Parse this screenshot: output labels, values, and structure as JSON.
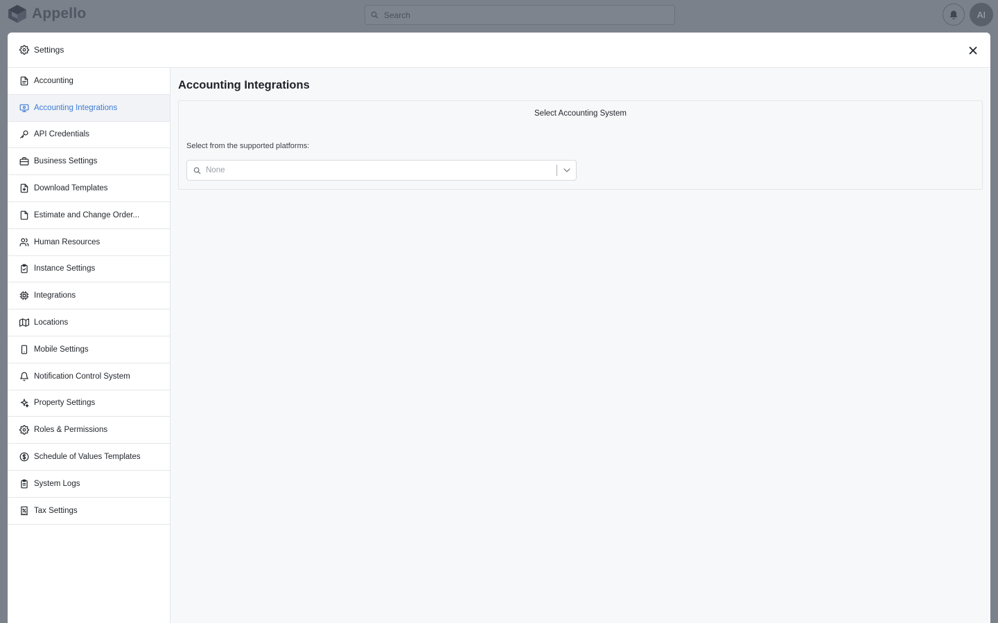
{
  "app": {
    "brand_name": "Appello",
    "search_placeholder": "Search",
    "avatar_initials": "AI"
  },
  "modal": {
    "title": "Settings"
  },
  "sidebar": {
    "items": [
      {
        "label": "Accounting",
        "icon": "file-text-icon"
      },
      {
        "label": "Accounting Integrations",
        "icon": "monitor-dollar-icon",
        "active": true
      },
      {
        "label": "API Credentials",
        "icon": "key-icon"
      },
      {
        "label": "Business Settings",
        "icon": "briefcase-icon"
      },
      {
        "label": "Download Templates",
        "icon": "file-download-icon"
      },
      {
        "label": "Estimate and Change Order...",
        "icon": "file-icon"
      },
      {
        "label": "Human Resources",
        "icon": "users-icon"
      },
      {
        "label": "Instance Settings",
        "icon": "clipboard-check-icon"
      },
      {
        "label": "Integrations",
        "icon": "chip-icon"
      },
      {
        "label": "Locations",
        "icon": "map-icon"
      },
      {
        "label": "Mobile Settings",
        "icon": "smartphone-icon"
      },
      {
        "label": "Notification Control System",
        "icon": "bell-icon"
      },
      {
        "label": "Property Settings",
        "icon": "sparkles-icon"
      },
      {
        "label": "Roles & Permissions",
        "icon": "gear-icon"
      },
      {
        "label": "Schedule of Values Templates",
        "icon": "dollar-circle-icon"
      },
      {
        "label": "System Logs",
        "icon": "clipboard-list-icon"
      },
      {
        "label": "Tax Settings",
        "icon": "receipt-percent-icon"
      }
    ]
  },
  "main": {
    "heading": "Accounting Integrations",
    "card_title": "Select Accounting System",
    "field_label": "Select from the supported platforms:",
    "select_value": "None"
  },
  "colors": {
    "accent": "#3d7bd6",
    "overlay": "#7b818b",
    "content_bg": "#f7f8fa"
  }
}
